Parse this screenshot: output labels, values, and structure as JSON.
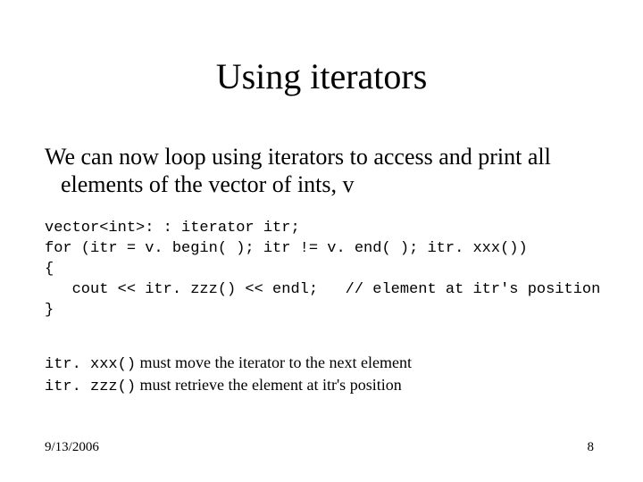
{
  "title": "Using iterators",
  "body": "We can now loop using iterators to access and print all elements of the vector of ints, v",
  "code": {
    "l1": "vector<int>: : iterator itr;",
    "l2": "for (itr = v. begin( ); itr != v. end( ); itr. xxx())",
    "l3": "{",
    "l4": "   cout << itr. zzz() << endl;   // element at itr's position",
    "l5": "}"
  },
  "notes": {
    "line1_mono": "itr. xxx()",
    "line1_rest": "  must move the iterator to the next element",
    "line2_mono": "itr. zzz()",
    "line2_rest": " must retrieve the element at itr's position"
  },
  "footer": {
    "date": "9/13/2006",
    "page": "8"
  }
}
